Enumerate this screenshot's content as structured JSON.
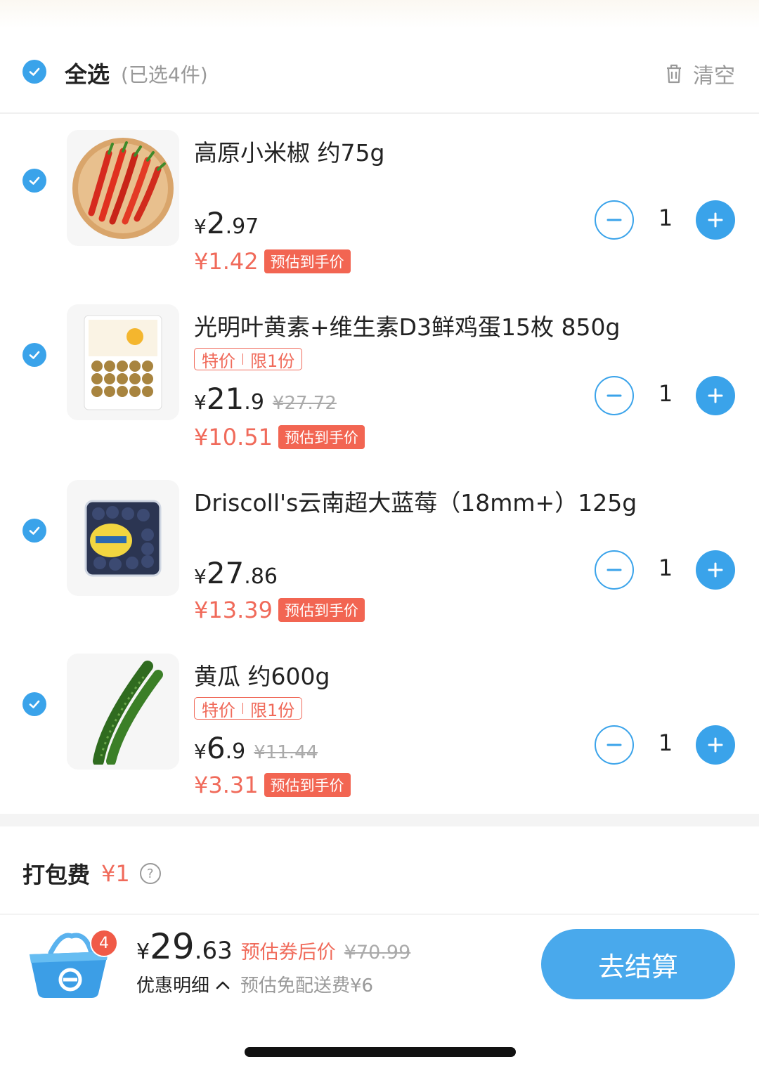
{
  "header": {
    "select_all": "全选",
    "selected_count": "(已选4件)",
    "clear_label": "清空"
  },
  "items": [
    {
      "title": "高原小米椒 约75g",
      "tag_special": "",
      "tag_limit": "",
      "price_currency": "¥",
      "price_int": "2",
      "price_dec": ".97",
      "price_orig": "",
      "est_price": "¥1.42",
      "est_label": "预估到手价",
      "qty": "1"
    },
    {
      "title": "光明叶黄素+维生素D3鲜鸡蛋15枚 850g",
      "tag_special": "特价",
      "tag_limit": "限1份",
      "price_currency": "¥",
      "price_int": "21",
      "price_dec": ".9",
      "price_orig": "¥27.72",
      "est_price": "¥10.51",
      "est_label": "预估到手价",
      "qty": "1"
    },
    {
      "title": "Driscoll's云南超大蓝莓（18mm+）125g",
      "tag_special": "",
      "tag_limit": "",
      "price_currency": "¥",
      "price_int": "27",
      "price_dec": ".86",
      "price_orig": "",
      "est_price": "¥13.39",
      "est_label": "预估到手价",
      "qty": "1"
    },
    {
      "title": "黄瓜 约600g",
      "tag_special": "特价",
      "tag_limit": "限1份",
      "price_currency": "¥",
      "price_int": "6",
      "price_dec": ".9",
      "price_orig": "¥11.44",
      "est_price": "¥3.31",
      "est_label": "预估到手价",
      "qty": "1"
    }
  ],
  "packing": {
    "label": "打包费",
    "fee": "¥1",
    "help": "?"
  },
  "footer": {
    "cart_count": "4",
    "total_currency": "¥",
    "total_int": "29",
    "total_dec": ".63",
    "total_label": "预估券后价",
    "total_orig": "¥70.99",
    "detail_label": "优惠明细",
    "free_delivery": "预估免配送费¥6",
    "checkout_label": "去结算"
  },
  "colors": {
    "accent": "#3aa3ea",
    "price_red": "#f06a5a",
    "checkout": "#49a9ec"
  }
}
